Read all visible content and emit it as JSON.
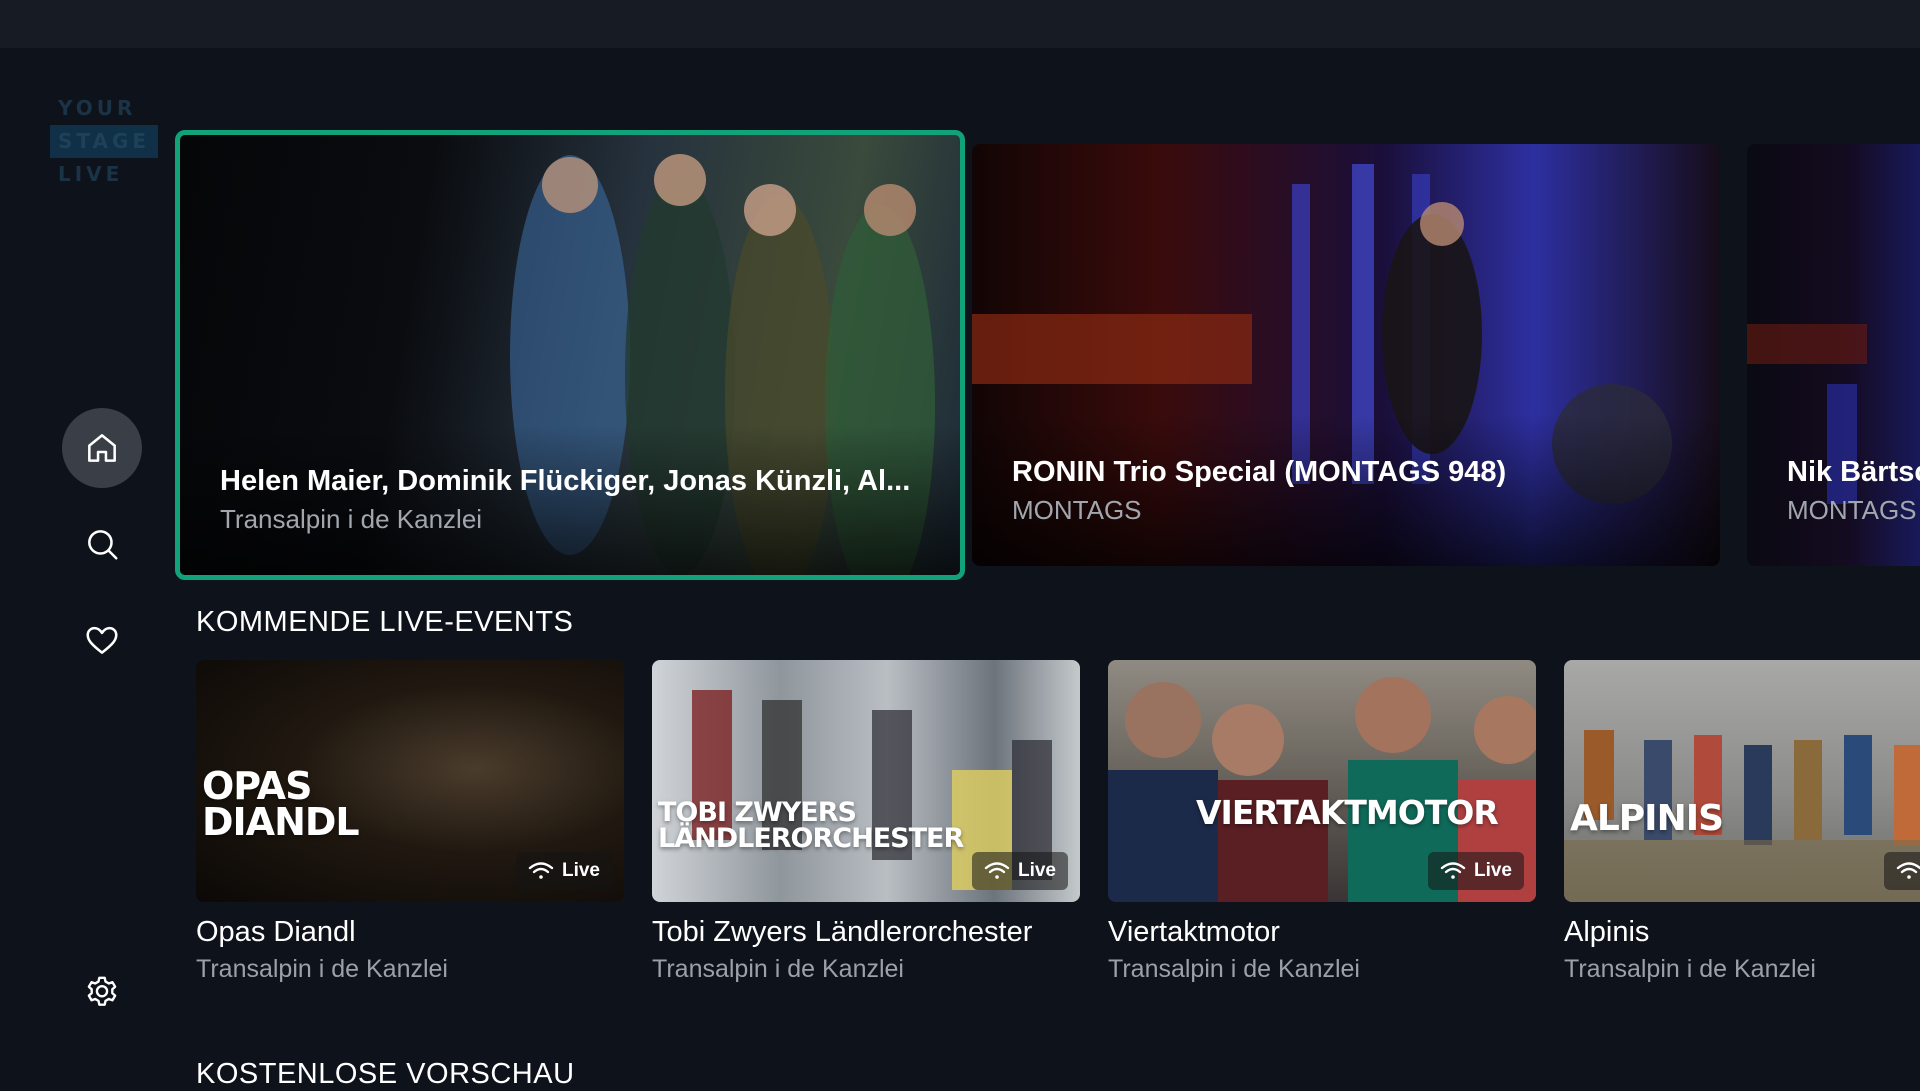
{
  "logo": {
    "line1": "YOUR",
    "line2": "STAGE",
    "line3": "LIVE"
  },
  "nav": {
    "home_icon": "home-icon",
    "search_icon": "search-icon",
    "favorites_icon": "heart-icon",
    "settings_icon": "gear-icon"
  },
  "hero": [
    {
      "title": "Helen Maier, Dominik Flückiger, Jonas Künzli, Al...",
      "subtitle": "Transalpin i de Kanzlei"
    },
    {
      "title": "RONIN Trio Special (MONTAGS 948)",
      "subtitle": "MONTAGS"
    },
    {
      "title": "Nik Bärtsc",
      "subtitle": "MONTAGS"
    }
  ],
  "sections": {
    "upcoming": "KOMMENDE LIVE-EVENTS",
    "preview": "KOSTENLOSE VORSCHAU"
  },
  "live_label": "Live",
  "events": [
    {
      "thumb_text": "OPAS\nDIANDL",
      "name": "Opas Diandl",
      "venue": "Transalpin i de Kanzlei"
    },
    {
      "thumb_text": "TOBI ZWYERS\nLÄNDLERORCHESTER",
      "name": "Tobi Zwyers Ländlerorchester",
      "venue": "Transalpin i de Kanzlei"
    },
    {
      "thumb_text": "VIERTAKTMOTOR",
      "name": "Viertaktmotor",
      "venue": "Transalpin i de Kanzlei"
    },
    {
      "thumb_text": "ALPINIS",
      "name": "Alpinis",
      "venue": "Transalpin i de Kanzlei"
    }
  ],
  "colors": {
    "focus_border": "#12a27a",
    "background": "#0e121b",
    "active_nav": "#3a3e46"
  }
}
